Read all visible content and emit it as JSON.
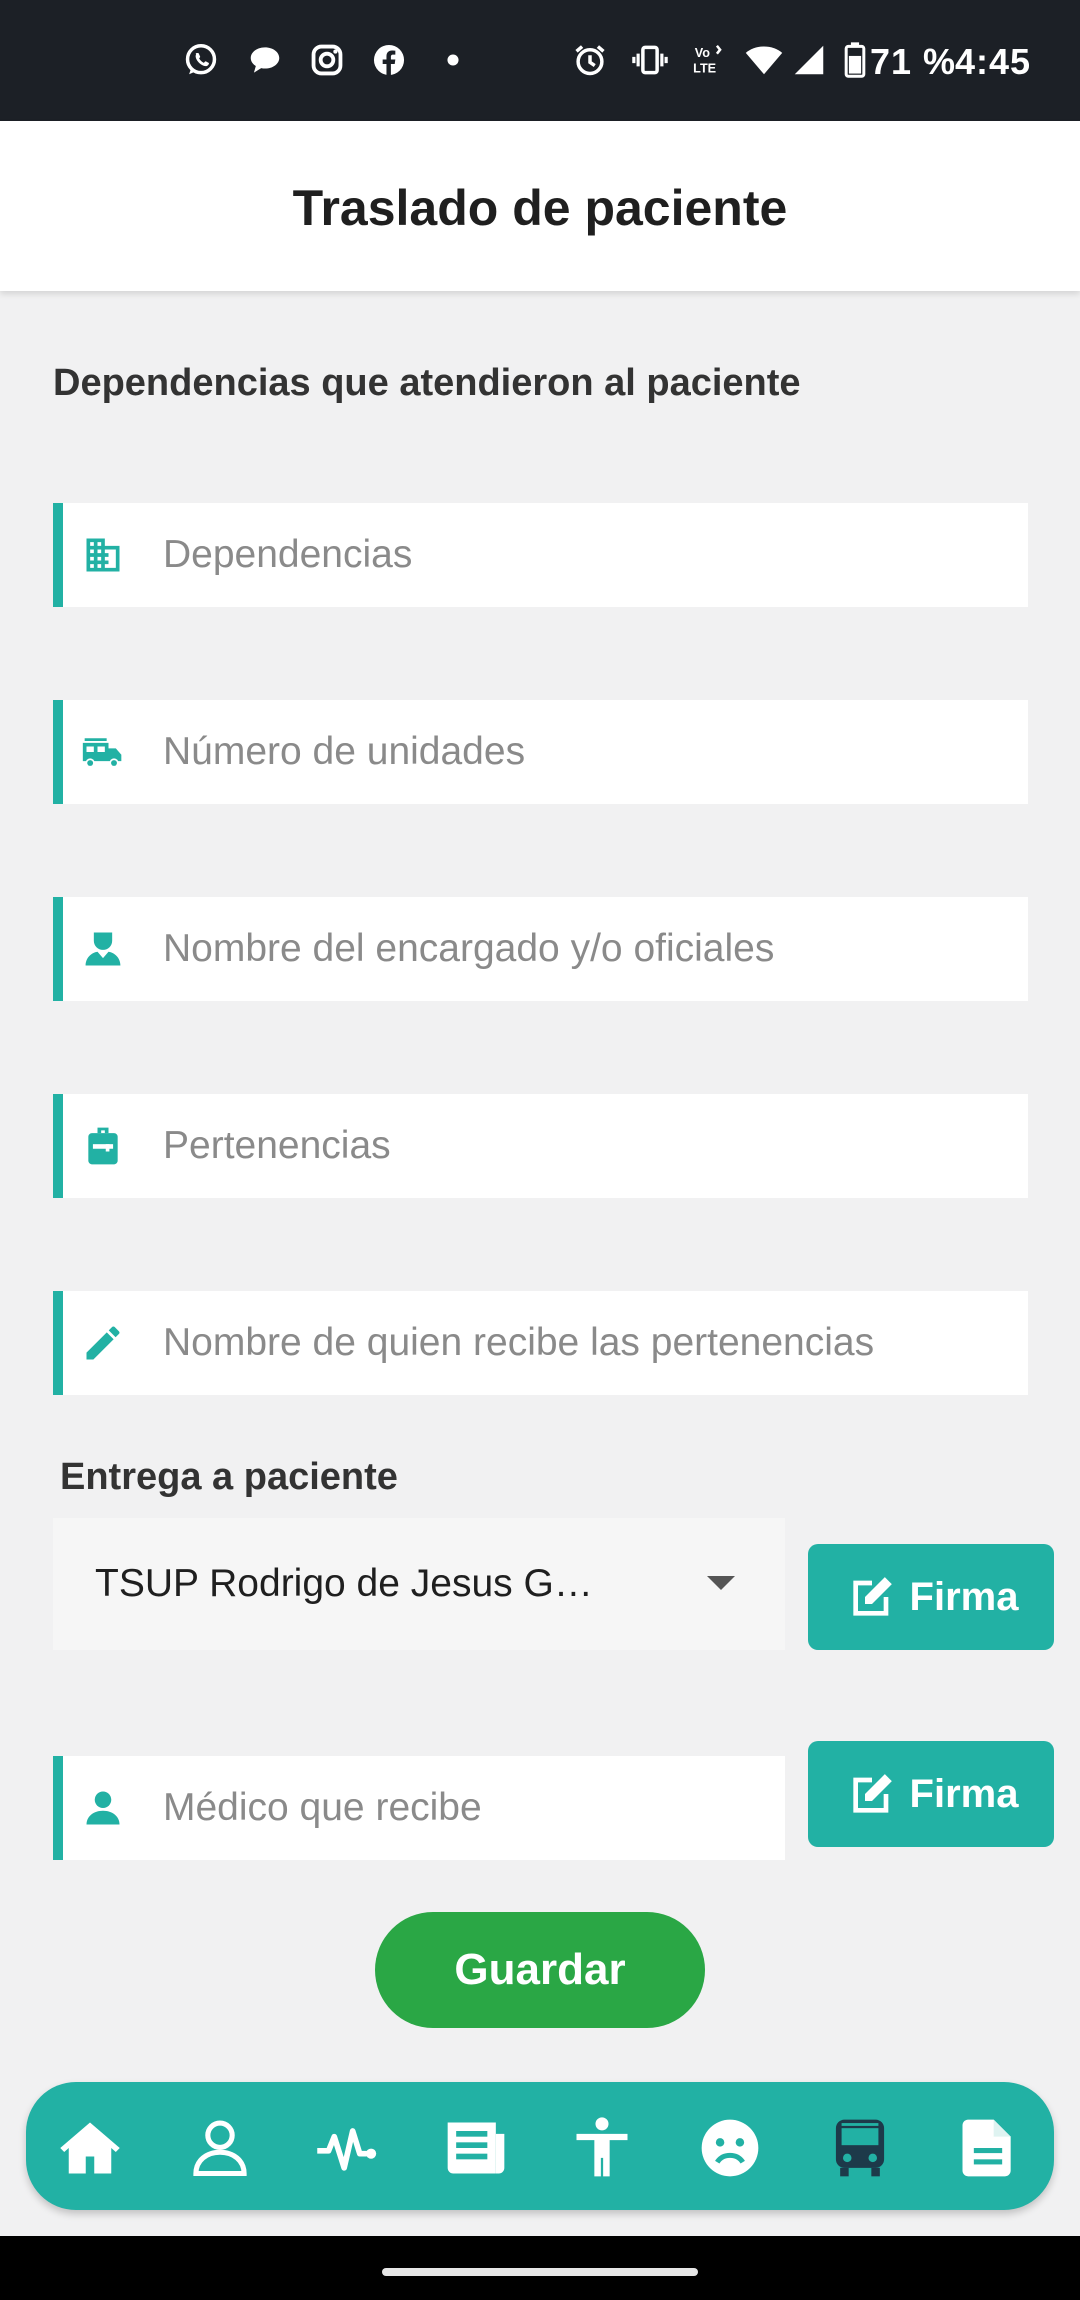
{
  "status_bar": {
    "battery": "71 %",
    "time": "4:45",
    "volte": "Vo LTE",
    "app_icons": [
      "whatsapp-icon",
      "messages-icon",
      "instagram-icon",
      "facebook-icon",
      "dot-icon"
    ],
    "system_icons": [
      "alarm-icon",
      "vibrate-icon",
      "volte-icon",
      "wifi-icon",
      "signal-icon",
      "battery-icon"
    ]
  },
  "header": {
    "title": "Traslado de paciente"
  },
  "section": {
    "title": "Dependencias que atendieron al paciente"
  },
  "fields": {
    "dependencias": {
      "placeholder": "Dependencias",
      "icon": "building-icon"
    },
    "unidades": {
      "placeholder": "Número de unidades",
      "icon": "fire-truck-icon"
    },
    "encargado": {
      "placeholder": "Nombre del encargado y/o oficiales",
      "icon": "officer-icon"
    },
    "pertenencias": {
      "placeholder": "Pertenencias",
      "icon": "backpack-icon"
    },
    "recibe_pertenencias": {
      "placeholder": "Nombre de quien recibe las pertenencias",
      "icon": "pencil-icon"
    },
    "medico": {
      "placeholder": "Médico que recibe",
      "icon": "user-icon"
    }
  },
  "entrega": {
    "label": "Entrega a paciente",
    "selected": "TSUP Rodrigo de Jesus G…"
  },
  "buttons": {
    "firma": "Firma",
    "guardar": "Guardar"
  },
  "bottom_nav": [
    "home-icon",
    "person-icon",
    "vitals-icon",
    "report-icon",
    "body-icon",
    "sad-face-icon",
    "bus-icon",
    "document-icon"
  ],
  "colors": {
    "accent": "#22b1a4",
    "save": "#2aa745",
    "statusbar": "#1c2026",
    "background": "#f1f1f2",
    "active_nav": "#1d3a4a"
  }
}
